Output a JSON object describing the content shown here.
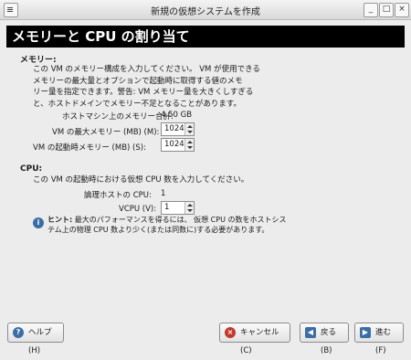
{
  "window": {
    "title": "新規の仮想システムを作成",
    "min_glyph": "_",
    "max_glyph": "□",
    "close_glyph": "×"
  },
  "banner": {
    "title": "メモリーと CPU の割り当て"
  },
  "memory": {
    "section_label": "メモリー:",
    "description_lines": [
      "この VM のメモリー構成を入力してください。 VM が使用できる",
      "メモリーの最大量とオプションで起動時に取得する値のメモ",
      "リー量を指定できます。警告: VM メモリー量を大きくしすぎる",
      "と、ホストドメインでメモリー不足となることがあります。"
    ],
    "host_total_label": "ホストマシン上のメモリー合計:",
    "host_total_value": "4.50 GB",
    "max_label": "VM の最大メモリー (MB) (M):",
    "max_value": "1024",
    "startup_label": "VM の起動時メモリー (MB) (S):",
    "startup_value": "1024"
  },
  "cpu": {
    "section_label": "CPU:",
    "description": "この VM の起動時における仮想 CPU 数を入力してください。",
    "logical_label": "論理ホストの CPU:",
    "logical_value": "1",
    "vcpu_label": "VCPU (V):",
    "vcpu_value": "1"
  },
  "hint": {
    "icon_glyph": "i",
    "label": "ヒント:",
    "text_line1": "最大のパフォーマンスを得るには、 仮想 CPU の数をホストシス",
    "text_line2": "テム上の物理 CPU 数より少く(または同数に)する必要があります。"
  },
  "buttons": {
    "help": "ヘルプ(H)",
    "cancel": "キャンセル(C)",
    "back": "戻る(B)",
    "forward": "進む(F)"
  },
  "colors": {
    "help_icon": "#3a6ea5",
    "cancel_icon": "#c0392b",
    "back_icon": "#3a6ea5",
    "forward_icon": "#3a6ea5"
  }
}
